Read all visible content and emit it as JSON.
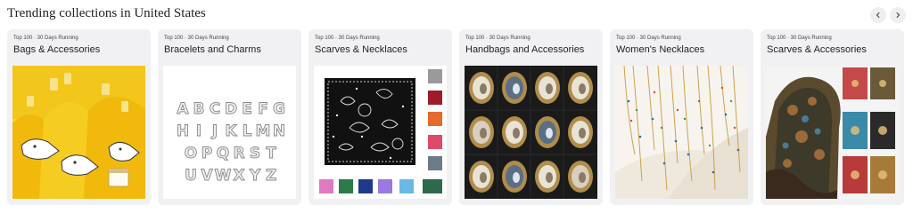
{
  "section": {
    "title": "Trending collections in United States",
    "prev_icon": "chevron-left-icon",
    "next_icon": "chevron-right-icon"
  },
  "cards": [
    {
      "meta": "Top 100 · 30 Days Running",
      "name": "Bags & Accessories",
      "image": "yellow-duck-bags"
    },
    {
      "meta": "Top 100 · 30 Days Running",
      "name": "Bracelets and Charms",
      "image": "silver-letter-charms"
    },
    {
      "meta": "Top 100 · 30 Days Running",
      "name": "Scarves & Necklaces",
      "image": "paisley-bandana"
    },
    {
      "meta": "Top 100 · 30 Days Running",
      "name": "Handbags and Accessories",
      "image": "cameo-brooches"
    },
    {
      "meta": "Top 100 · 30 Days Running",
      "name": "Women's Necklaces",
      "image": "beaded-chain-necklaces"
    },
    {
      "meta": "Top 100 · 30 Days Running",
      "name": "Scarves & Accessories",
      "image": "printed-silk-scarves"
    }
  ],
  "charm_letters": [
    "A",
    "B",
    "C",
    "D",
    "E",
    "F",
    "G",
    "H",
    "I",
    "J",
    "K",
    "L",
    "M",
    "N",
    "O",
    "P",
    "Q",
    "R",
    "S",
    "T",
    "U",
    "V",
    "W",
    "X",
    "Y",
    "Z"
  ]
}
